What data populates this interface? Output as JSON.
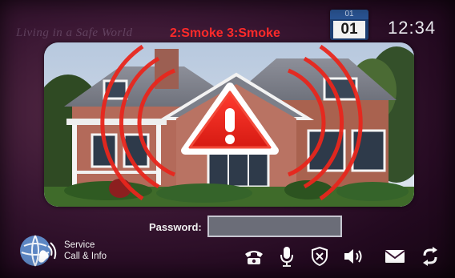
{
  "header": {
    "brand": "Living in a Safe World",
    "alarm": "2:Smoke 3:Smoke",
    "date": {
      "month": "01",
      "day": "01"
    },
    "time": "12:34"
  },
  "video": {
    "alarm_icon": "warning-triangle-icon",
    "alarm_color": "#ff2a2a"
  },
  "password": {
    "label": "Password:",
    "value": ""
  },
  "service": {
    "icon": "globe-phone-icon",
    "line1": "Service",
    "line2": "Call & Info"
  },
  "toolbar": {
    "buttons": [
      {
        "name": "phone",
        "icon": "phone-icon"
      },
      {
        "name": "microphone",
        "icon": "microphone-icon"
      },
      {
        "name": "security",
        "icon": "shield-icon"
      },
      {
        "name": "volume",
        "icon": "speaker-icon"
      },
      {
        "name": "messages",
        "icon": "envelope-icon"
      },
      {
        "name": "refresh",
        "icon": "refresh-icon"
      }
    ]
  },
  "colors": {
    "alarm_red": "#ff2a2a",
    "date_blue": "#1d3f73",
    "background": "#3a1733"
  }
}
